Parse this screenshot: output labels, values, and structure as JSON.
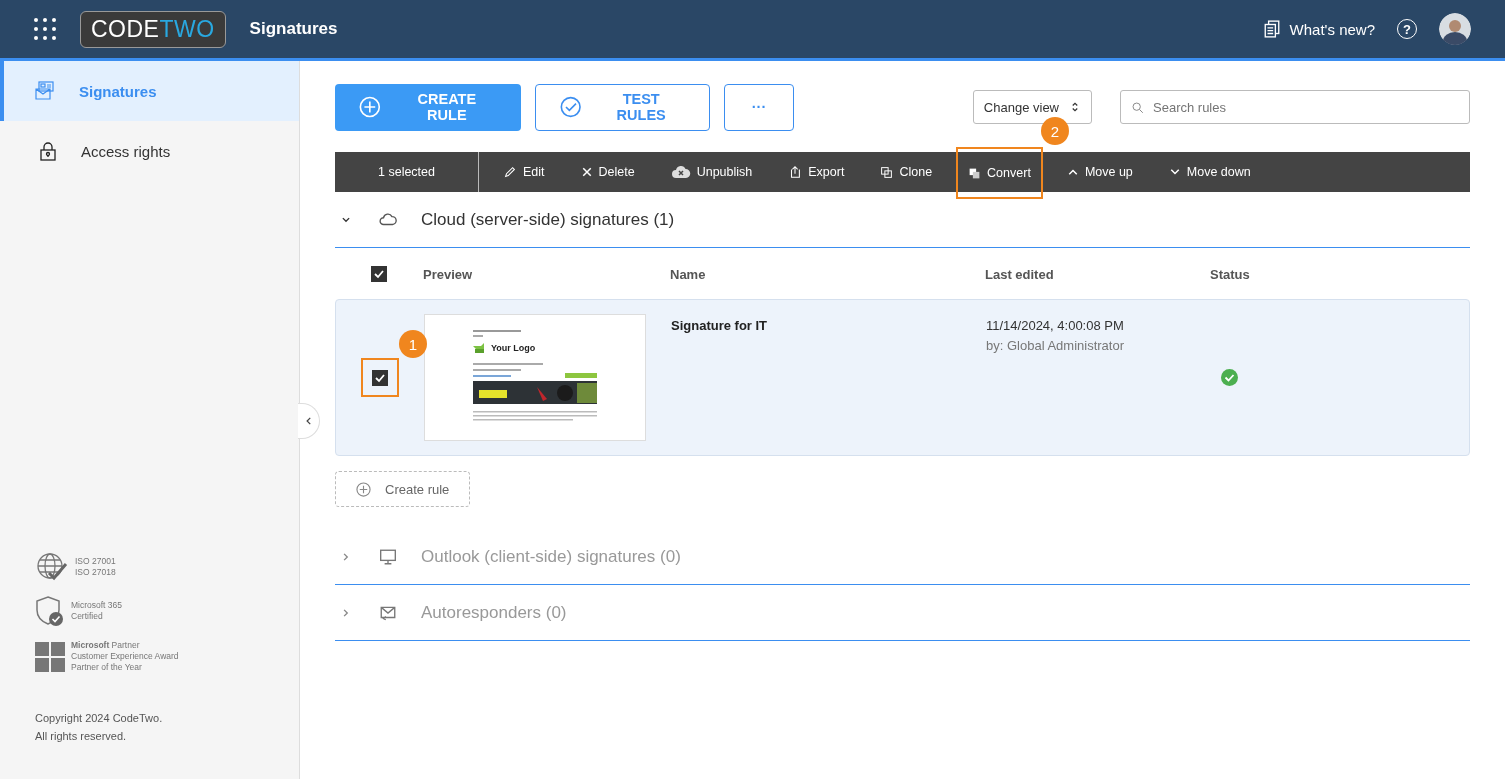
{
  "header": {
    "logo": {
      "part1": "CODE",
      "part2": "TWO"
    },
    "app_title": "Signatures",
    "whats_new": "What's new?",
    "help": "?"
  },
  "sidebar": {
    "items": [
      {
        "label": "Signatures",
        "selected": true
      },
      {
        "label": "Access rights",
        "selected": false
      }
    ],
    "badges": [
      {
        "lines": [
          "ISO 27001",
          "ISO 27018"
        ]
      },
      {
        "lines": [
          "Microsoft 365",
          "Certified"
        ]
      },
      {
        "lines": [
          "**Microsoft** Partner",
          "Customer Experience Award",
          "Partner of the Year"
        ]
      }
    ],
    "copyright": [
      "Copyright 2024 CodeTwo.",
      "All rights reserved."
    ]
  },
  "actions": {
    "create": "CREATE RULE",
    "test": "TEST RULES",
    "more": "···",
    "view": "Change view",
    "search_placeholder": "Search rules"
  },
  "toolbar": {
    "selection": "1 selected",
    "items": [
      {
        "label": "Edit",
        "highlighted": false
      },
      {
        "label": "Delete",
        "highlighted": false
      },
      {
        "label": "Unpublish",
        "highlighted": false
      },
      {
        "label": "Export",
        "highlighted": false
      },
      {
        "label": "Clone",
        "highlighted": false
      },
      {
        "label": "Convert",
        "highlighted": true,
        "callout": "2"
      },
      {
        "label": "Move up",
        "highlighted": false
      },
      {
        "label": "Move down",
        "highlighted": false
      }
    ]
  },
  "sections": [
    {
      "title": "Cloud (server-side) signatures (1)",
      "expanded": true,
      "columns": [
        "Preview",
        "Name",
        "Last edited",
        "Status"
      ],
      "all_checked": true,
      "rows": [
        {
          "preview": {
            "logo_text": "Your Logo"
          },
          "name": "Signature for IT",
          "edited": "11/14/2024, 4:00:08 PM",
          "by": "by: Global Administrator",
          "checked": true,
          "highlighted": true,
          "callout": "1",
          "published": true
        }
      ],
      "add_label": "Create rule"
    },
    {
      "title": "Outlook (client-side) signatures (0)",
      "expanded": false
    },
    {
      "title": "Autoresponders (0)",
      "expanded": false
    }
  ]
}
